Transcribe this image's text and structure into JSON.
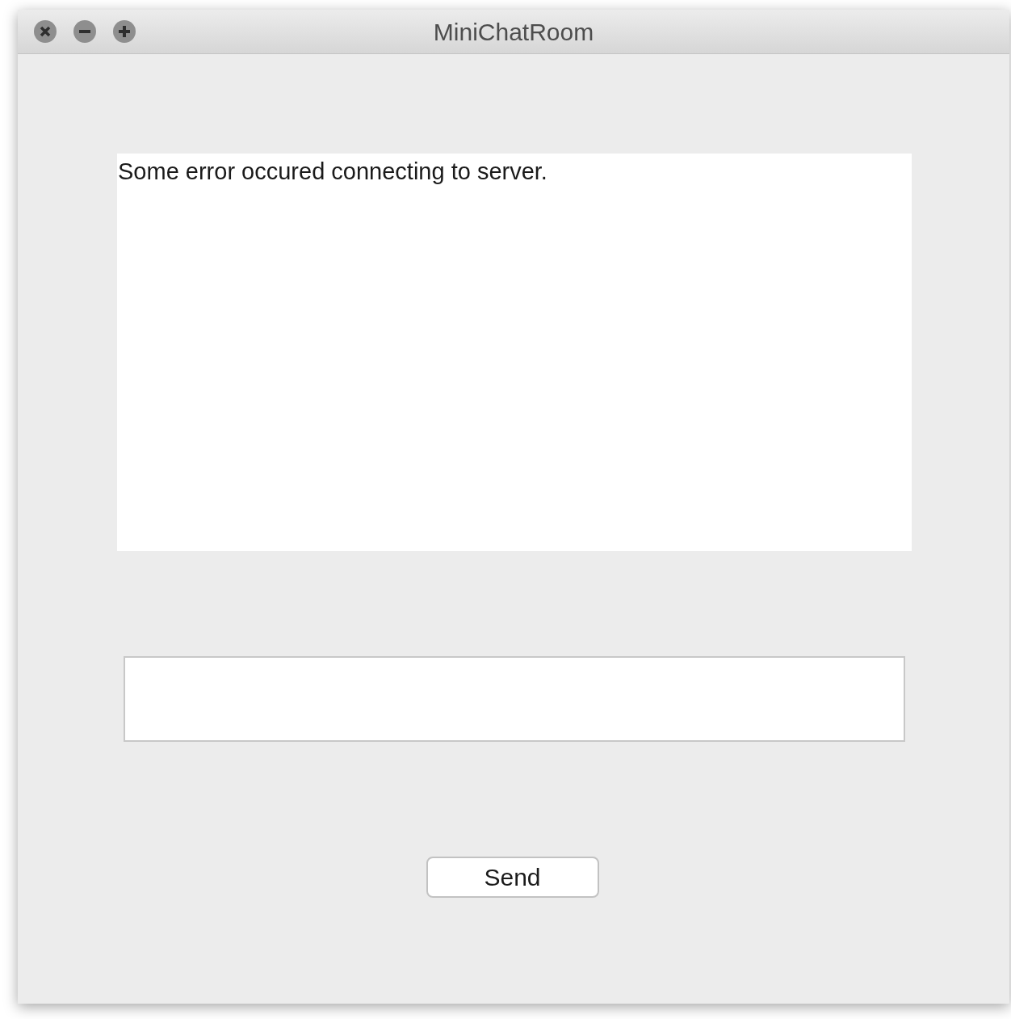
{
  "window": {
    "title": "MiniChatRoom"
  },
  "chat_log": {
    "text": "Some error occured connecting to server."
  },
  "send_button": {
    "label": "Send"
  }
}
